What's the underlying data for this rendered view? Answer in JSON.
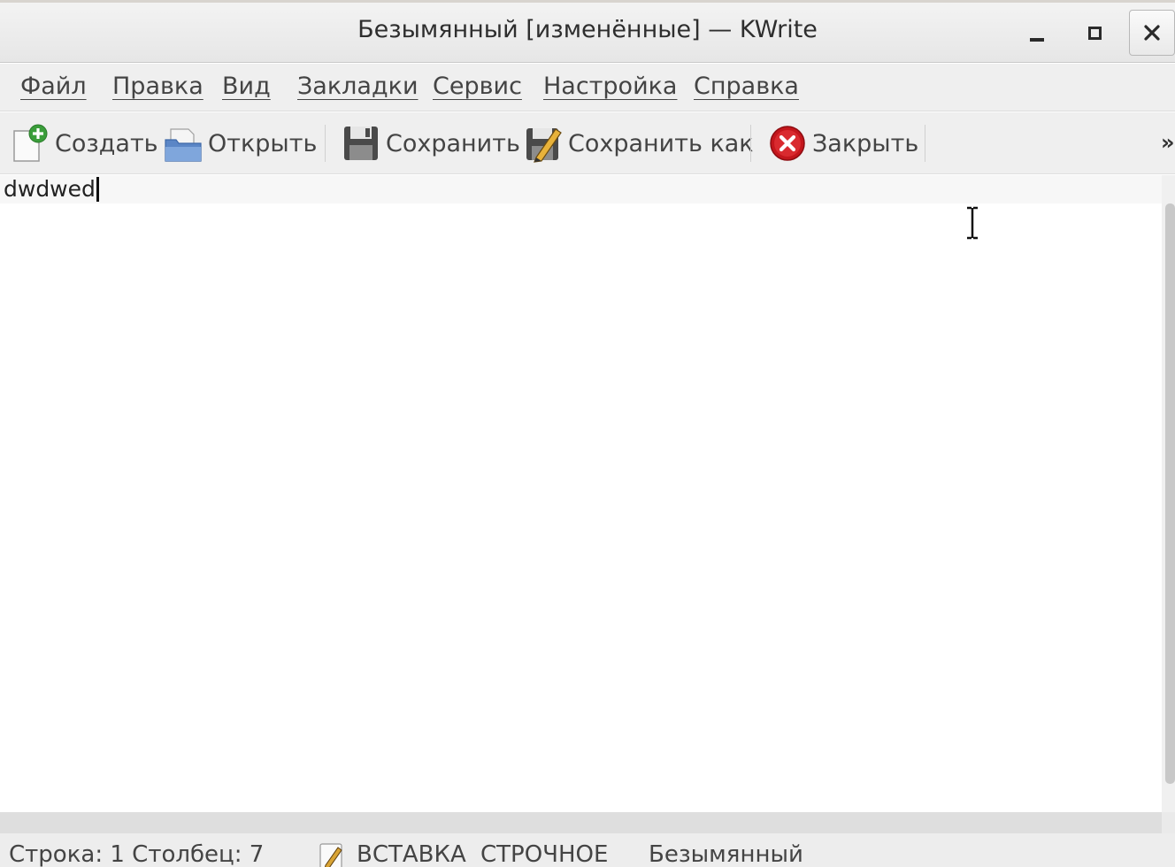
{
  "window": {
    "title": "Безымянный [изменённые] — KWrite"
  },
  "menubar": {
    "items": [
      {
        "label": "Файл"
      },
      {
        "label": "Правка"
      },
      {
        "label": "Вид"
      },
      {
        "label": "Закладки"
      },
      {
        "label": "Сервис"
      },
      {
        "label": "Настройка"
      },
      {
        "label": "Справка"
      }
    ]
  },
  "toolbar": {
    "new_label": "Создать",
    "open_label": "Открыть",
    "save_label": "Сохранить",
    "save_as_label": "Сохранить как",
    "close_label": "Закрыть",
    "overflow_label": "»"
  },
  "editor": {
    "text": "dwdwed"
  },
  "statusbar": {
    "position": "Строка: 1 Столбец: 7",
    "mode": "ВСТАВКА",
    "selection_mode": "СТРОЧНОЕ",
    "document_name": "Безымянный"
  }
}
